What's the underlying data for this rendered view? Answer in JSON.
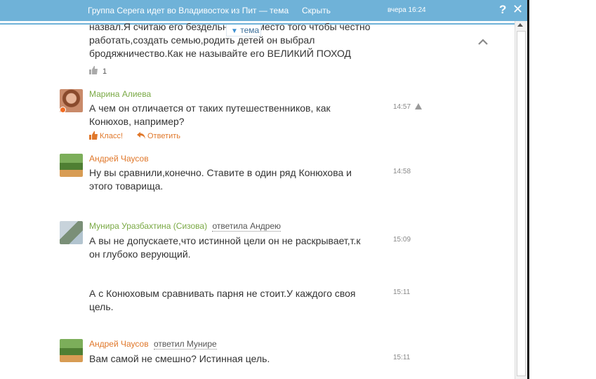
{
  "topbar": {
    "title": "Группа Серега идет во Владивосток из Пит — тема",
    "hide_label": "Скрыть",
    "time": "вчера 16:24",
    "help": "?",
    "close": "✕"
  },
  "topic_tab": {
    "label": "тема",
    "arrow": "▼"
  },
  "first_post": {
    "lines": [
      "назвал.Я считаю его бездельником вместо того чтобы честно",
      "работать,создать семью,родить детей он выбрал",
      "бродяжничество.Как не называйте его ВЕЛИКИЙ ПОХОД"
    ],
    "like_count": "1"
  },
  "comments": [
    {
      "author": "Марина Алиева",
      "lines": [
        "А  чем он отличается от таких путешественников, как",
        "Конюхов, например?"
      ],
      "time": "14:57",
      "actions": {
        "like": "Класс!",
        "reply": "Ответить"
      }
    },
    {
      "author": "Андрей Чаусов",
      "lines": [
        "Ну вы сравнили,конечно. Ставите в один ряд Конюхова и",
        "этого товарища."
      ],
      "time": "14:58"
    },
    {
      "author": "Мунира Уразбахтина (Сизова)",
      "reply_to": "ответила Андрею",
      "lines": [
        "А вы не допускаете,что истинной цели он не раскрывает,т.к",
        "он глубоко верующий."
      ],
      "time": "15:09"
    },
    {
      "lines": [
        "А с Конюховым сравнивать парня не стоит.У каждого своя",
        "цель."
      ],
      "time": "15:11"
    },
    {
      "author": "Андрей Чаусов",
      "reply_to": "ответил Мунире",
      "lines": [
        "Вам самой не смешно? Истинная цель."
      ],
      "time": "15:11"
    }
  ],
  "colors": {
    "header_bg": "#6fb2d8",
    "author_green": "#7aa945",
    "author_orange": "#e0782b",
    "action_orange": "#e0782b"
  }
}
